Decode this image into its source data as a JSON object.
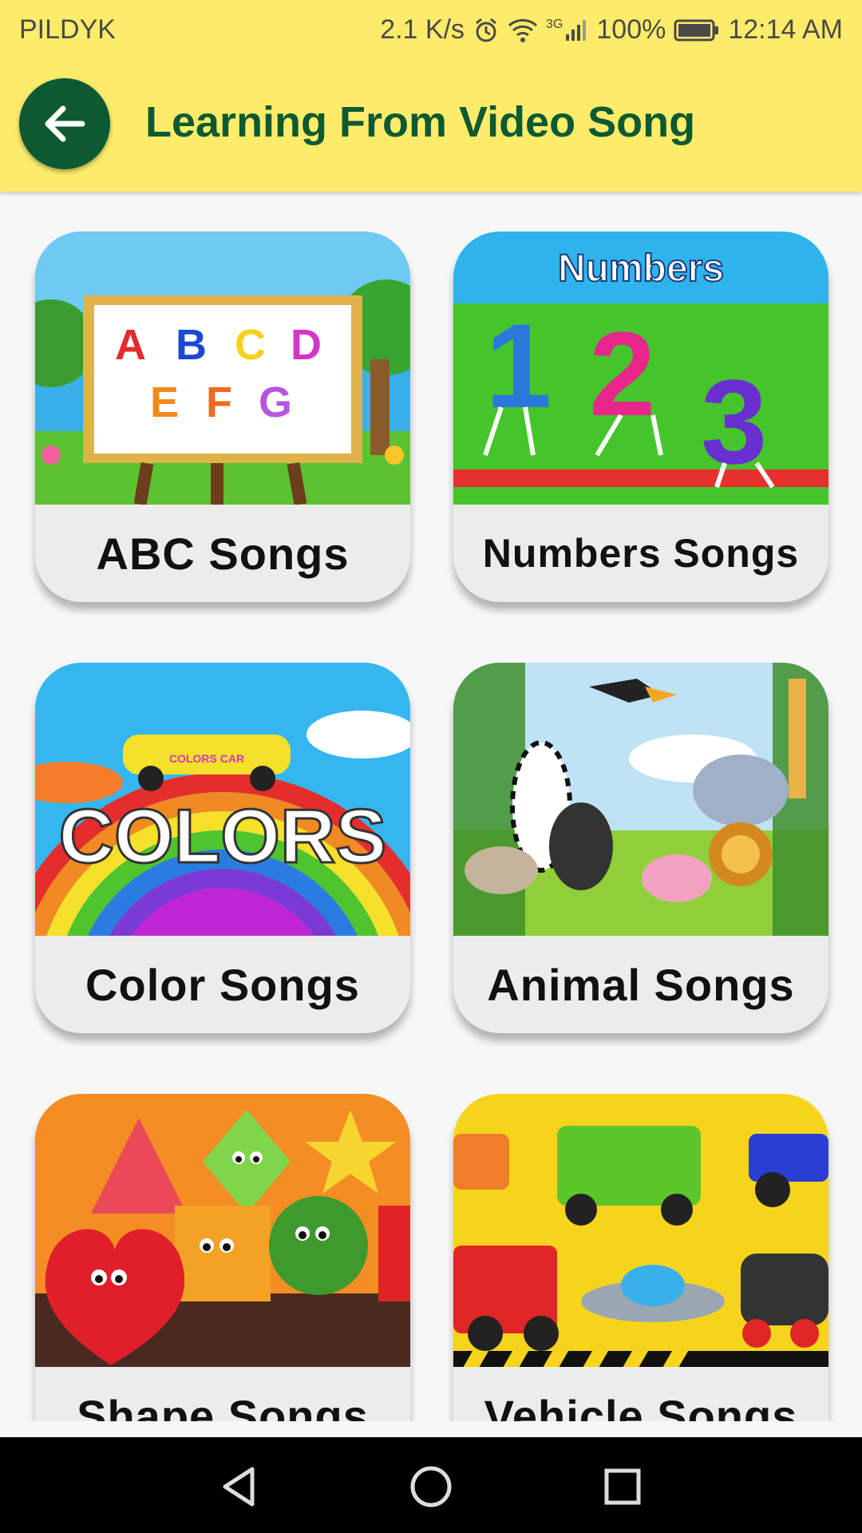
{
  "status_bar": {
    "carrier": "PILDYK",
    "speed": "2.1 K/s",
    "network": "3G",
    "battery": "100%",
    "time": "12:14 AM"
  },
  "header": {
    "title": "Learning From Video Song",
    "back_icon": "arrow-left-icon",
    "color_bg": "#fdec6a",
    "color_accent": "#0d5a32"
  },
  "categories": [
    {
      "label": "ABC Songs",
      "art_text": [
        "A",
        "B",
        "C",
        "D",
        "E",
        "F",
        "G"
      ]
    },
    {
      "label": "Numbers Songs",
      "art_title": "Numbers",
      "art_text": [
        "1",
        "2",
        "3"
      ]
    },
    {
      "label": "Color Songs",
      "art_title": "COLORS",
      "art_sub": "COLORS CAR"
    },
    {
      "label": "Animal Songs"
    },
    {
      "label": "Shape Songs"
    },
    {
      "label": "Vehicle Songs"
    }
  ],
  "nav_bar": {
    "back": "triangle-back-icon",
    "home": "circle-home-icon",
    "recents": "square-recents-icon"
  }
}
